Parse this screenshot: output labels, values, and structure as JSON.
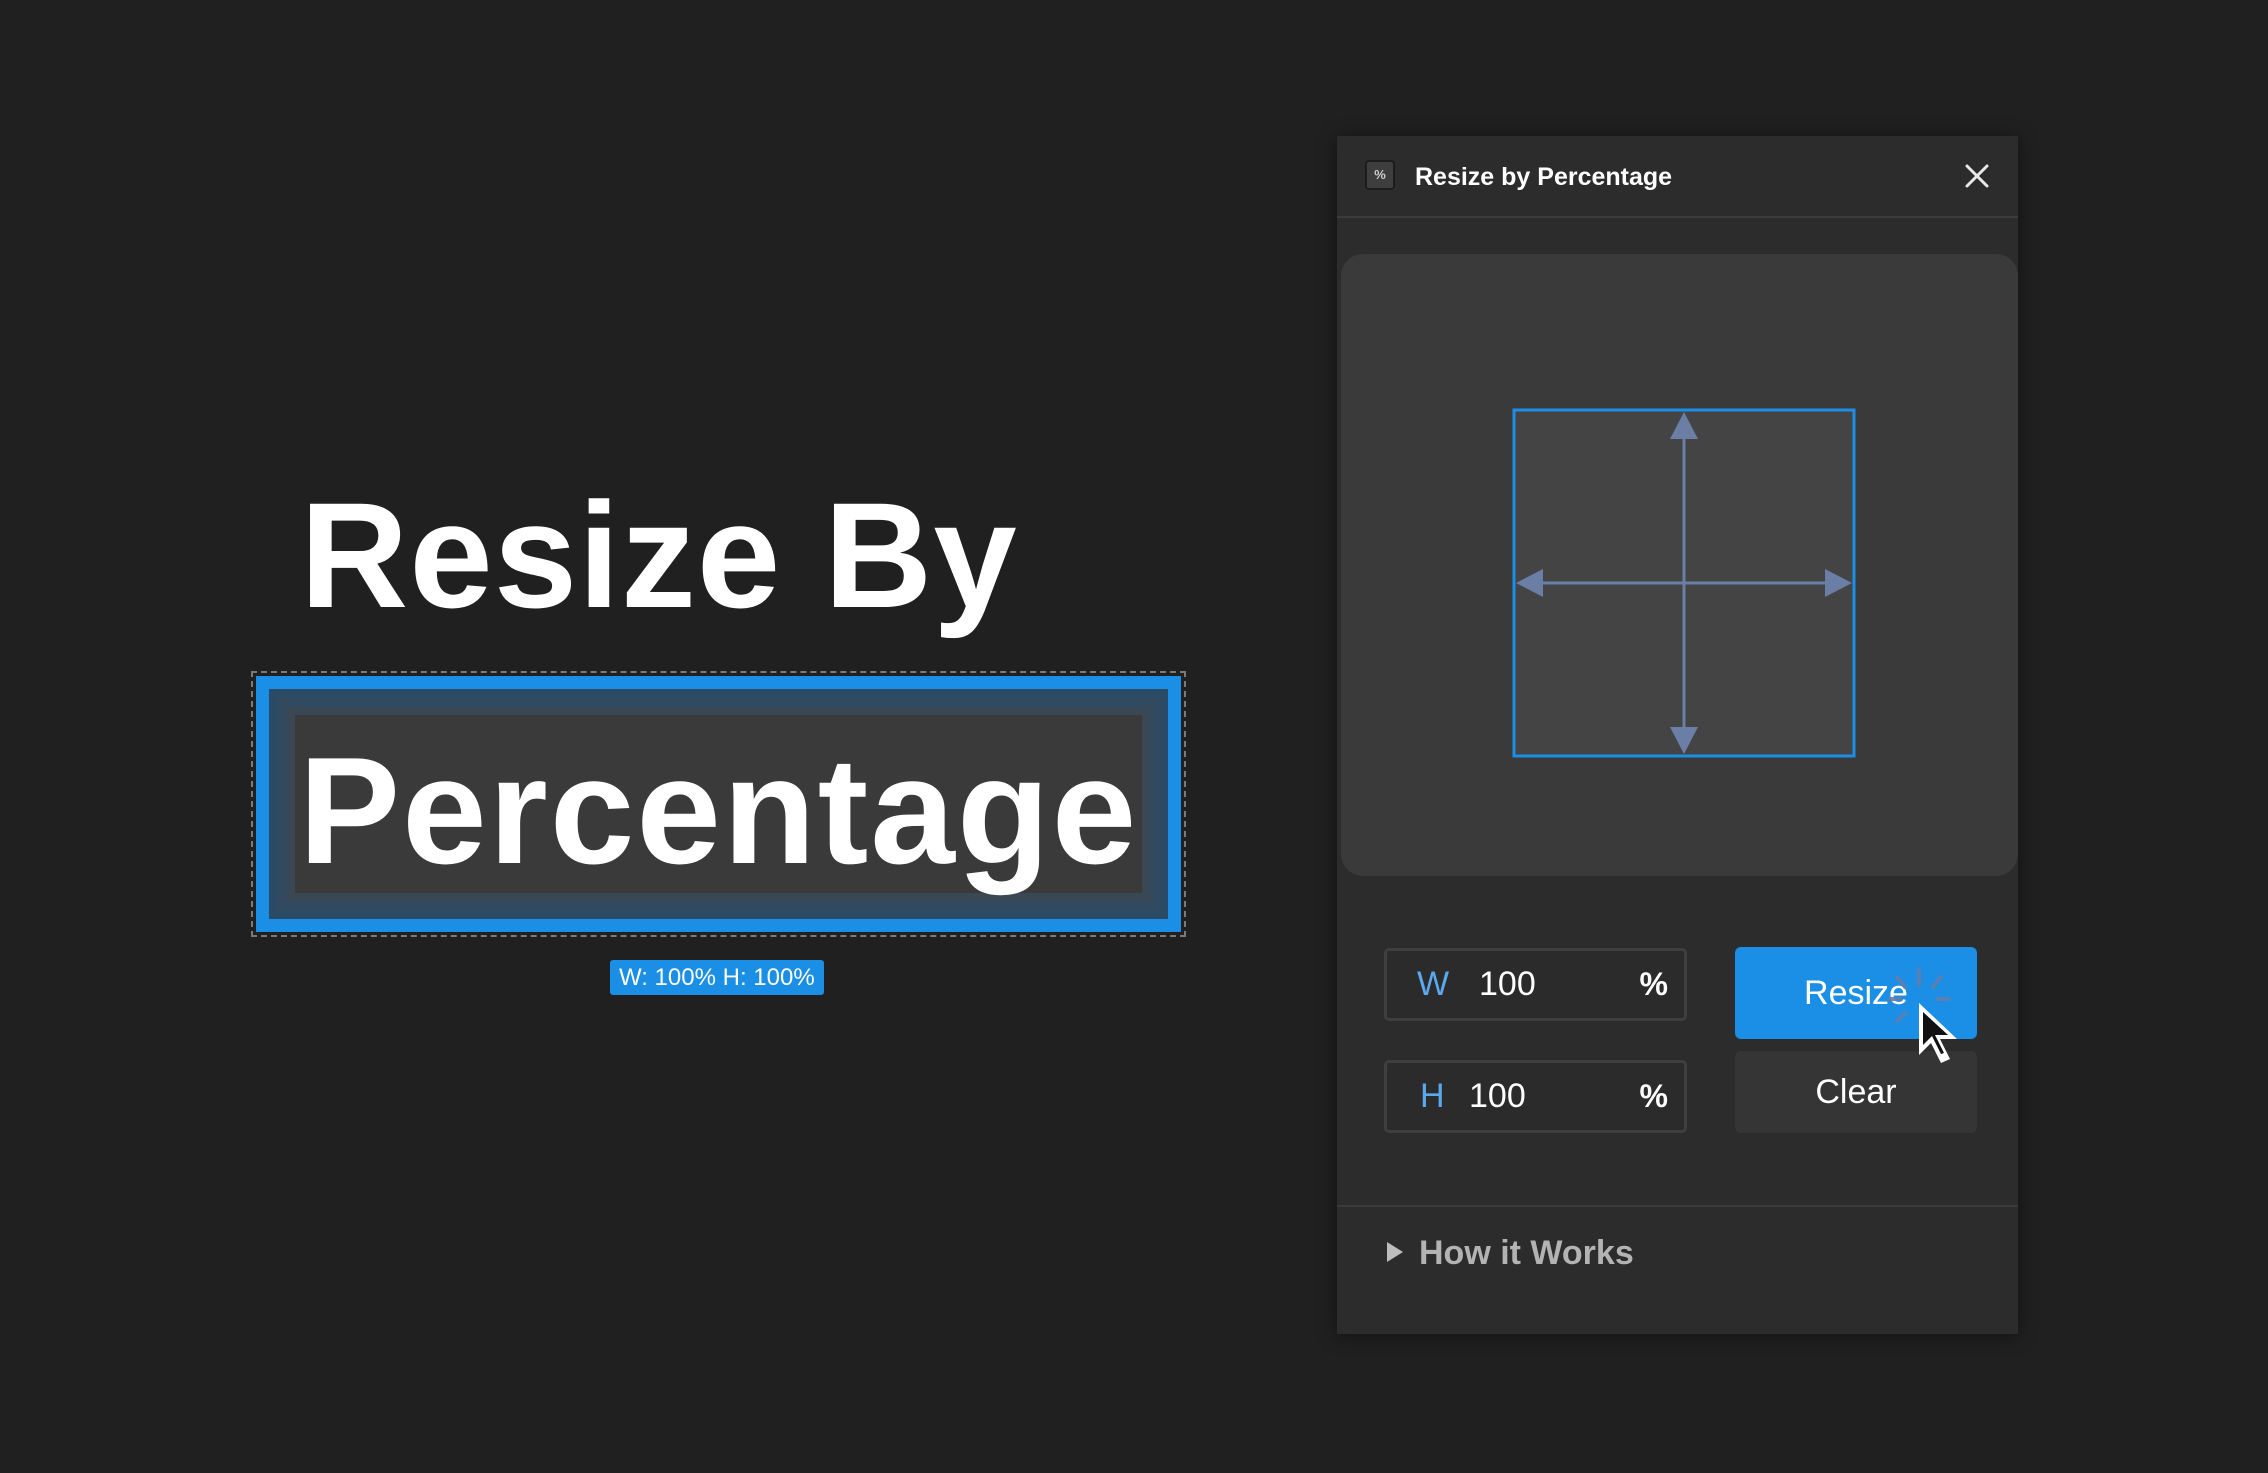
{
  "hero": {
    "line1": "Resize By",
    "line2": "Percentage",
    "size_badge": "W: 100% H: 100%"
  },
  "panel": {
    "icon_glyph": "%",
    "title": "Resize by Percentage",
    "close_icon": "close-icon",
    "preview_icon": "resize-arrows-icon",
    "width_field": {
      "label": "W",
      "value": "100",
      "unit": "%"
    },
    "height_field": {
      "label": "H",
      "value": "100",
      "unit": "%"
    },
    "resize_label": "Resize",
    "clear_label": "Clear",
    "how_it_works_label": "How it Works"
  },
  "colors": {
    "accent": "#1b8ee6",
    "canvas_bg": "#202020",
    "panel_bg": "#2c2c2c",
    "preview_bg": "#3a3a3a",
    "arrow": "#6a7ea6",
    "field_label": "#5aa9ee"
  }
}
